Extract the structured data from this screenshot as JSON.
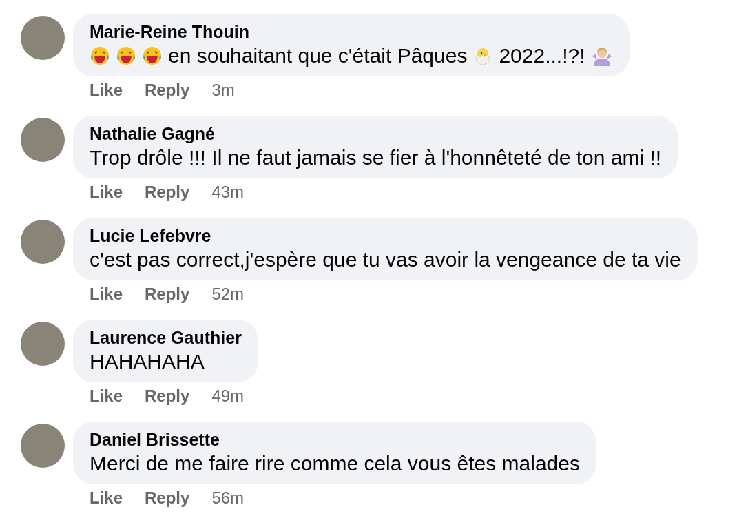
{
  "comments": [
    {
      "author": "Marie-Reine Thouin",
      "message": [
        {
          "kind": "laugh"
        },
        {
          "kind": "laugh"
        },
        {
          "kind": "laugh"
        },
        {
          "kind": "text",
          "text": "en souhaitant que c'était Pâques"
        },
        {
          "kind": "chick"
        },
        {
          "kind": "text",
          "text": "2022...!?!"
        },
        {
          "kind": "shrug"
        }
      ],
      "actions": [
        "Like",
        "Reply"
      ],
      "time": "3m"
    },
    {
      "author": "Nathalie Gagné",
      "message": [
        {
          "kind": "text",
          "text": "Trop drôle !!! Il ne faut jamais se fier à l'honnêteté de ton ami !!"
        }
      ],
      "actions": [
        "Like",
        "Reply"
      ],
      "time": "43m"
    },
    {
      "author": "Lucie Lefebvre",
      "message": [
        {
          "kind": "text",
          "text": "c'est pas correct,j'espère que tu vas avoir la vengeance de ta vie"
        }
      ],
      "actions": [
        "Like",
        "Reply"
      ],
      "time": "52m"
    },
    {
      "author": "Laurence Gauthier",
      "message": [
        {
          "kind": "text",
          "text": "HAHAHAHA"
        }
      ],
      "actions": [
        "Like",
        "Reply"
      ],
      "time": "49m"
    },
    {
      "author": "Daniel Brissette",
      "message": [
        {
          "kind": "text",
          "text": "Merci de me faire rire comme cela vous êtes malades"
        }
      ],
      "actions": [
        "Like",
        "Reply"
      ],
      "time": "56m"
    }
  ]
}
